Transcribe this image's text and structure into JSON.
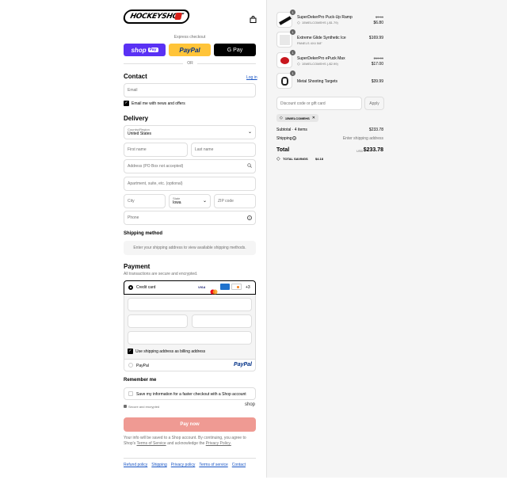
{
  "header": {
    "logo": "HOCKEYSHOT"
  },
  "express": {
    "title": "Express checkout",
    "shoppay": "shop",
    "shoppay_badge": "Pay",
    "paypal": "PayPal",
    "gpay": "G Pay",
    "or": "OR"
  },
  "contact": {
    "title": "Contact",
    "login": "Log in",
    "email_placeholder": "Email",
    "news_label": "Email me with news and offers"
  },
  "delivery": {
    "title": "Delivery",
    "country_label": "Country/Region",
    "country": "United States",
    "first_name": "First name",
    "last_name": "Last name",
    "address": "Address (PO Box not accepted)",
    "apartment": "Apartment, suite, etc. (optional)",
    "city": "City",
    "state_label": "State",
    "state": "Iowa",
    "zip": "ZIP code",
    "phone": "Phone"
  },
  "shipping": {
    "title": "Shipping method",
    "note": "Enter your shipping address to view available shipping methods."
  },
  "payment": {
    "title": "Payment",
    "subtitle": "All transactions are secure and encrypted.",
    "credit_card": "Credit card",
    "card_brands": [
      "VISA",
      "MC",
      "AMEX",
      "DISCOVER"
    ],
    "more": "+3",
    "billing_label": "Use shipping address as billing address",
    "paypal_label": "PayPal",
    "paypal_logo": "PayPal"
  },
  "remember": {
    "title": "Remember me",
    "save_label": "Save my information for a faster checkout with a Shop account",
    "secure": "Secure and encrypted",
    "shop": "shop"
  },
  "pay_button": "Pay now",
  "legal": {
    "text": "Your info will be saved to a Shop account. By continuing, you agree to Shop's",
    "terms": "Terms of Service",
    "and": "and acknowledge the",
    "privacy": "Privacy Policy."
  },
  "footer_links": [
    "Refund policy",
    "Shipping",
    "Privacy policy",
    "Terms of service",
    "Contact"
  ],
  "cart": {
    "items": [
      {
        "qty": "1",
        "name": "SuperDekerPro Puck-Up Ramp",
        "sub": "15WELCOMEHS (-$1.79)",
        "old_price": "$7.99",
        "price": "$6.80"
      },
      {
        "qty": "1",
        "name": "Extreme Glide Synthetic Ice",
        "sub": "PANELS 4X4 5/8\"",
        "old_price": "",
        "price": "$169.99"
      },
      {
        "qty": "1",
        "name": "SuperDekerPro ePuck Max",
        "sub": "15WELCOMEHS (-$2.99)",
        "old_price": "$19.99",
        "price": "$17.00"
      },
      {
        "qty": "1",
        "name": "Metal Shooting Targets",
        "sub": "",
        "old_price": "",
        "price": "$39.99"
      }
    ],
    "discount_placeholder": "Discount code or gift card",
    "apply": "Apply",
    "code_tag": "15WELCOMEHS",
    "subtotal_label": "Subtotal · 4 items",
    "subtotal": "$233.78",
    "shipping_label": "Shipping",
    "shipping_value": "Enter shipping address",
    "total_label": "Total",
    "currency": "USD",
    "total": "$233.78",
    "savings_label": "TOTAL SAVINGS",
    "savings": "$4.18"
  },
  "colors": {
    "shoppay": "#5a31f4",
    "paypal": "#ffc439",
    "pay_button": "#ef9a93",
    "accent": "#1a56c5"
  }
}
